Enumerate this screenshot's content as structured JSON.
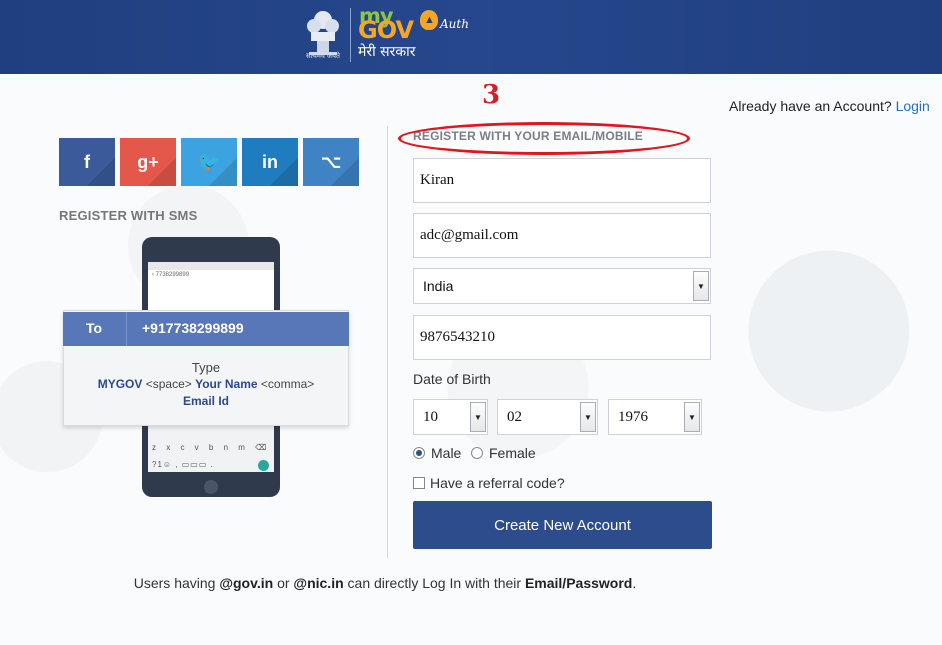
{
  "header": {
    "emblem_caption": "सत्यमेव जयते",
    "logo_my": "my",
    "logo_gov": "GOV",
    "logo_auth": "Auth",
    "logo_hindi": "मेरी सरकार"
  },
  "annotation": {
    "step_number": "3"
  },
  "already_account": {
    "text": "Already have an Account? ",
    "login_link": "Login"
  },
  "social": {
    "facebook": "f",
    "google_plus": "g+",
    "twitter": "🐦",
    "linkedin": "in",
    "github": "⌥"
  },
  "sms": {
    "title": "REGISTER WITH SMS",
    "phone_search": "‹   7738299899",
    "to_label": "To",
    "to_number": "+917738299899",
    "type_label": "Type",
    "format_mygov": "MYGOV",
    "format_space": "<space>",
    "format_name": "Your Name",
    "format_comma": "<comma>",
    "format_email": "Email Id",
    "kb_row1": "z x c v b n m ⌫",
    "kb_row2": "?1☺ ,  ▭▭▭  ."
  },
  "form": {
    "title": "REGISTER WITH YOUR EMAIL/MOBILE",
    "name_value": "Kiran",
    "email_value": "adc@gmail.com",
    "country_value": "India",
    "phone_value": "9876543210",
    "dob_label": "Date of Birth",
    "dob_day": "10",
    "dob_month": "02",
    "dob_year": "1976",
    "gender_male": "Male",
    "gender_female": "Female",
    "gender_selected": "Male",
    "referral_label": "Have a referral code?",
    "submit_label": "Create New Account"
  },
  "footer": {
    "part1": "Users having ",
    "gov_domain": "@gov.in",
    "part2": " or ",
    "nic_domain": "@nic.in",
    "part3": " can directly Log In with their ",
    "credentials": "Email/Password",
    "part4": "."
  },
  "colors": {
    "header_bg": "#27478d",
    "primary_button": "#2c4c8b",
    "annotation_red": "#e0151e",
    "facebook": "#3b5a9a",
    "google_plus": "#e4574b",
    "twitter": "#3da3e0",
    "linkedin": "#1f7cbf",
    "github": "#3f83c5"
  }
}
